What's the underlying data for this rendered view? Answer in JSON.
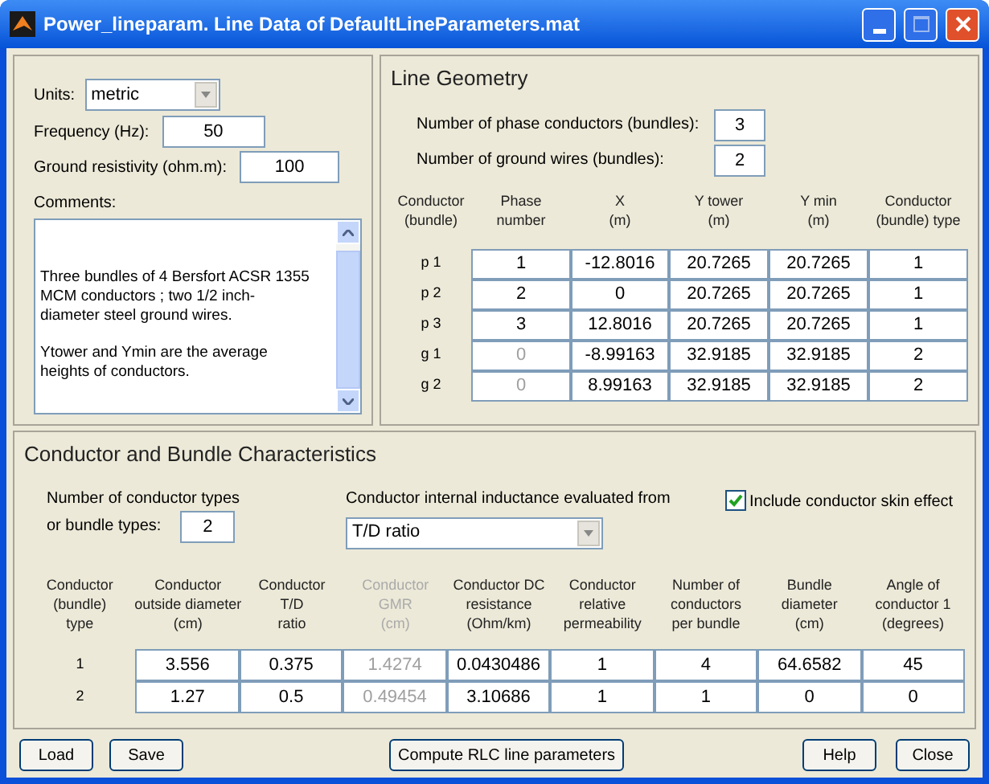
{
  "window": {
    "title": "Power_lineparam. Line Data of DefaultLineParameters.mat"
  },
  "general": {
    "units_label": "Units:",
    "units": "metric",
    "frequency_label": "Frequency (Hz):",
    "frequency": "50",
    "resistivity_label": "Ground resistivity (ohm.m):",
    "resistivity": "100",
    "comments_label": "Comments:",
    "comments": [
      "Three bundles of 4 Bersfort ACSR 1355 MCM conductors ; two 1/2 inch-diameter steel ground wires.",
      "Ytower and Ymin are the average heights of conductors."
    ]
  },
  "geometry": {
    "title": "Line Geometry",
    "phase_label": "Number of phase conductors (bundles):",
    "phase_count": "3",
    "ground_label": "Number of ground wires (bundles):",
    "ground_count": "2",
    "columns": [
      "Conductor\n(bundle)",
      "Phase\nnumber",
      "X\n(m)",
      "Y tower\n(m)",
      "Y min\n(m)",
      "Conductor\n(bundle) type"
    ],
    "rows": [
      {
        "cells": [
          {
            "value": "p 1",
            "disabled": false
          },
          {
            "value": "1",
            "disabled": false
          },
          {
            "value": "-12.8016",
            "disabled": false
          },
          {
            "value": "20.7265",
            "disabled": false
          },
          {
            "value": "20.7265",
            "disabled": false
          },
          {
            "value": "1",
            "disabled": false
          }
        ]
      },
      {
        "cells": [
          {
            "value": "p 2",
            "disabled": false
          },
          {
            "value": "2",
            "disabled": false
          },
          {
            "value": "0",
            "disabled": false
          },
          {
            "value": "20.7265",
            "disabled": false
          },
          {
            "value": "20.7265",
            "disabled": false
          },
          {
            "value": "1",
            "disabled": false
          }
        ]
      },
      {
        "cells": [
          {
            "value": "p 3",
            "disabled": false
          },
          {
            "value": "3",
            "disabled": false
          },
          {
            "value": "12.8016",
            "disabled": false
          },
          {
            "value": "20.7265",
            "disabled": false
          },
          {
            "value": "20.7265",
            "disabled": false
          },
          {
            "value": "1",
            "disabled": false
          }
        ]
      },
      {
        "cells": [
          {
            "value": "g 1",
            "disabled": false
          },
          {
            "value": "0",
            "disabled": true
          },
          {
            "value": "-8.99163",
            "disabled": false
          },
          {
            "value": "32.9185",
            "disabled": false
          },
          {
            "value": "32.9185",
            "disabled": false
          },
          {
            "value": "2",
            "disabled": false
          }
        ]
      },
      {
        "cells": [
          {
            "value": "g 2",
            "disabled": false
          },
          {
            "value": "0",
            "disabled": true
          },
          {
            "value": "8.99163",
            "disabled": false
          },
          {
            "value": "32.9185",
            "disabled": false
          },
          {
            "value": "32.9185",
            "disabled": false
          },
          {
            "value": "2",
            "disabled": false
          }
        ]
      }
    ]
  },
  "characteristics": {
    "title": "Conductor and Bundle Characteristics",
    "types_label": [
      "Number of conductor types",
      "or bundle types:"
    ],
    "types_count": "2",
    "inductance_label": "Conductor internal inductance evaluated from",
    "inductance_method": "T/D ratio",
    "skin_effect": {
      "label": "Include conductor skin effect",
      "checked": true
    },
    "columns": [
      {
        "label": "Conductor\n(bundle)\ntype",
        "disabled": false
      },
      {
        "label": "Conductor\noutside diameter\n(cm)",
        "disabled": false
      },
      {
        "label": "Conductor\nT/D\nratio",
        "disabled": false
      },
      {
        "label": "Conductor\nGMR\n(cm)",
        "disabled": true
      },
      {
        "label": "Conductor DC\nresistance\n(Ohm/km)",
        "disabled": false
      },
      {
        "label": "Conductor\nrelative\npermeability",
        "disabled": false
      },
      {
        "label": "Number of\nconductors\nper bundle",
        "disabled": false
      },
      {
        "label": "Bundle\ndiameter\n(cm)",
        "disabled": false
      },
      {
        "label": "Angle of\nconductor 1\n(degrees)",
        "disabled": false
      }
    ],
    "rows": [
      {
        "cells": [
          "1",
          "3.556",
          "0.375",
          "1.4274",
          "0.0430486",
          "1",
          "4",
          "64.6582",
          "45"
        ]
      },
      {
        "cells": [
          "2",
          "1.27",
          "0.5",
          "0.49454",
          "3.10686",
          "1",
          "1",
          "0",
          "0"
        ]
      }
    ]
  },
  "buttons": {
    "left": [
      "Load",
      "Save"
    ],
    "center": [
      "Compute RLC line parameters"
    ],
    "right": [
      "Help",
      "Close"
    ]
  }
}
